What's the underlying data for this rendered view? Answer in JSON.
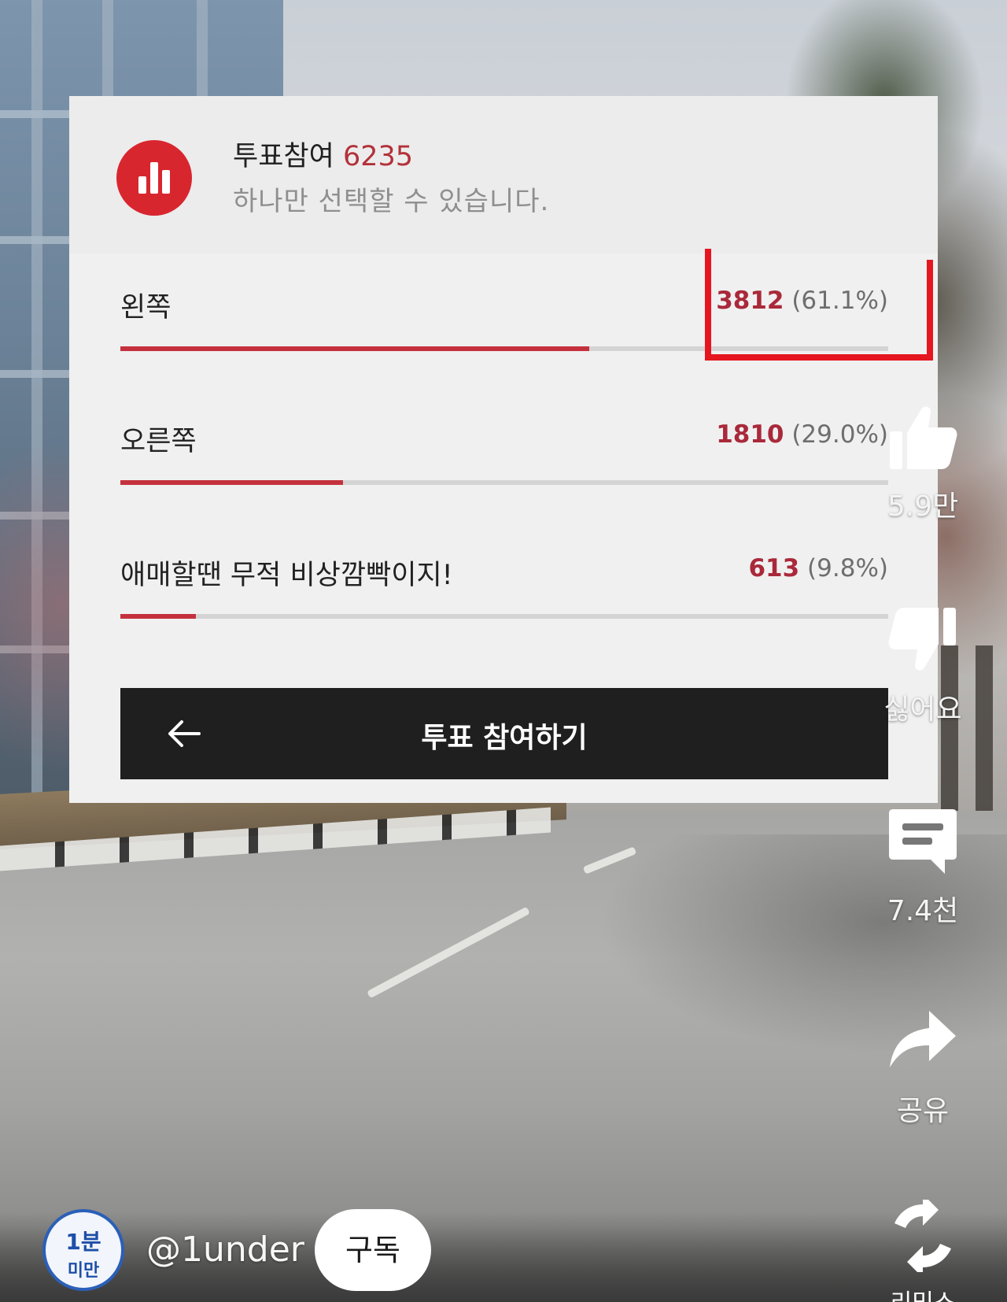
{
  "poll": {
    "title": "투표참여",
    "total_votes": "6235",
    "subtitle": "하나만 선택할 수 있습니다.",
    "options": [
      {
        "label": "왼쪽",
        "votes": "3812",
        "percent_text": "(61.1%)",
        "fraction": 0.611
      },
      {
        "label": "오른쪽",
        "votes": "1810",
        "percent_text": "(29.0%)",
        "fraction": 0.29
      },
      {
        "label": "애매할땐 무적 비상깜빡이지!",
        "votes": "613",
        "percent_text": "(9.8%)",
        "fraction": 0.098
      }
    ],
    "submit_label": "투표 참여하기",
    "back_icon": "arrow-left-icon"
  },
  "actions": {
    "like": {
      "icon": "thumbs-up-icon",
      "label": "5.9만"
    },
    "dislike": {
      "icon": "thumbs-down-icon",
      "label": "싫어요"
    },
    "comments": {
      "icon": "comment-icon",
      "label": "7.4천"
    },
    "share": {
      "icon": "share-icon",
      "label": "공유"
    },
    "remix": {
      "icon": "remix-icon",
      "label": "리믹스"
    }
  },
  "channel": {
    "avatar_line1": "1분",
    "avatar_line2": "미만",
    "handle": "@1under",
    "subscribe_label": "구독"
  },
  "colors": {
    "accent": "#d8262f",
    "highlight_box": "#e5161f",
    "button_dark": "#1f1f1f"
  }
}
